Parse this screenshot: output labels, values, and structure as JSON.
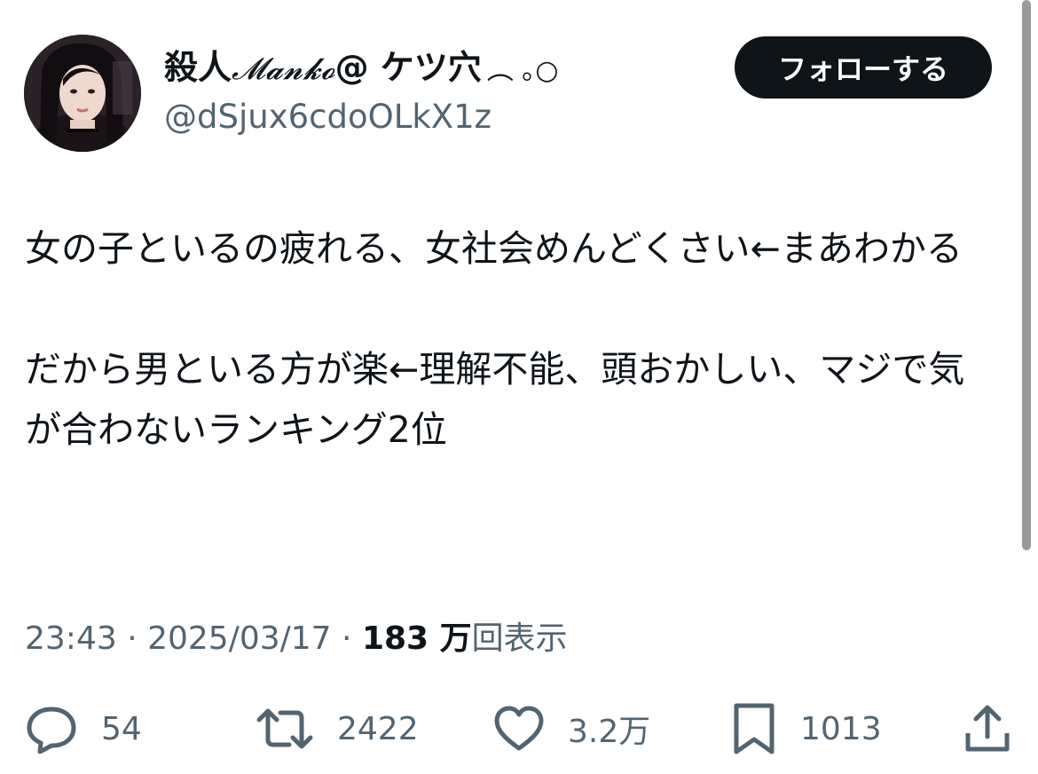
{
  "author": {
    "name_prefix": "殺人",
    "name_script": "𝓜𝓪𝓷𝓴𝓸",
    "name_suffix": "@ ケツ穴",
    "name_deco": "︵ ｡○",
    "handle": "@dSjux6cdoOLkX1z"
  },
  "follow_button": {
    "label": "フォローする"
  },
  "tweet": {
    "paragraph1": "女の子といるの疲れる、女社会めんどくさい←まあわかる",
    "paragraph2": "だから男といる方が楽←理解不能、頭おかしい、マジで気が合わないランキング2位"
  },
  "meta": {
    "time": "23:43",
    "separator": " · ",
    "date": "2025/03/17",
    "views_count": "183 万",
    "views_label": "回表示"
  },
  "actions": {
    "reply_count": "54",
    "retweet_count": "2422",
    "like_count": "3.2万",
    "bookmark_count": "1013"
  },
  "icons": {
    "reply": "reply-icon",
    "retweet": "retweet-icon",
    "like": "heart-icon",
    "bookmark": "bookmark-icon",
    "share": "share-icon"
  },
  "colors": {
    "text": "#0f1419",
    "secondary": "#536471",
    "button_bg": "#0f1419",
    "button_text": "#ffffff"
  }
}
